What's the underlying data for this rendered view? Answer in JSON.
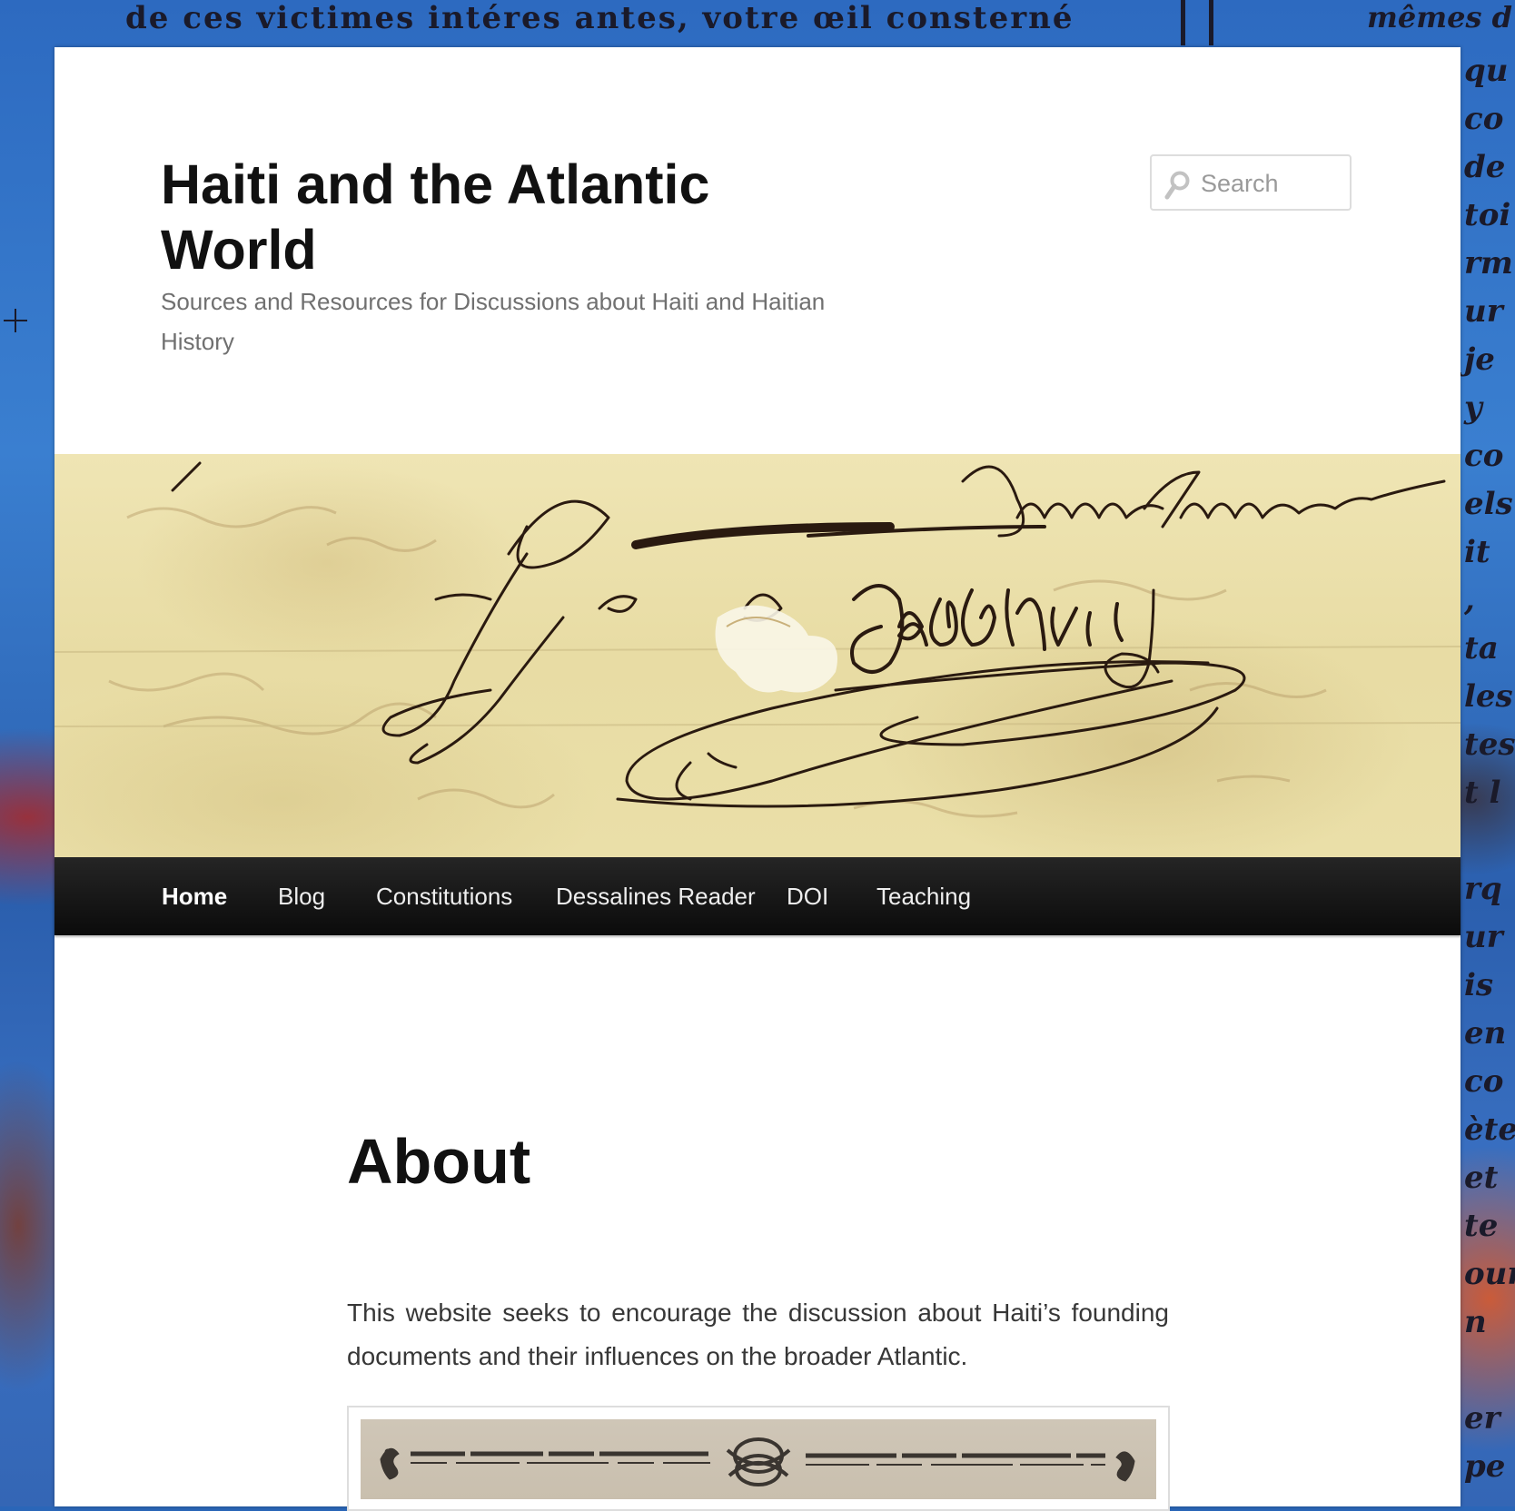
{
  "background": {
    "top_line": "de ces victimes intéres antes, votre œil consterné",
    "top_right": "mêmes d",
    "margin_column": [
      "qu",
      "co",
      "de",
      "toi",
      "rm",
      "ur",
      "je",
      "y co",
      "els",
      "it",
      ",",
      "ta",
      "les",
      "tes",
      "t l",
      "",
      "rq",
      "ur",
      "is",
      "en",
      "co",
      "ète",
      "et",
      "te",
      "our",
      "n",
      "",
      "er",
      "pe"
    ]
  },
  "site": {
    "title": "Haiti and the Atlantic World",
    "description": "Sources and Resources for Discussions about Haiti and Haitian History"
  },
  "search": {
    "placeholder": "Search",
    "value": ""
  },
  "nav": {
    "items": [
      {
        "label": "Home",
        "active": true
      },
      {
        "label": "Blog",
        "active": false
      },
      {
        "label": "Constitutions",
        "active": false
      },
      {
        "label": "Dessalines Reader",
        "active": false
      },
      {
        "label": "DOI",
        "active": false
      },
      {
        "label": "Teaching",
        "active": false
      }
    ]
  },
  "content": {
    "title": "About",
    "paragraph": "This website seeks to encourage the discussion about Haiti’s founding documents and their influences on the broader Atlantic."
  },
  "colors": {
    "nav_background": "#111111",
    "nav_text": "#eeeeee",
    "title_text": "#111111",
    "description_text": "#707070",
    "parchment": "#ebdfa8",
    "ink": "#2a1a10",
    "page_bg": "#ffffff",
    "backdrop_blue": "#2f6cc0"
  },
  "icons": {
    "search": "magnifier-icon"
  }
}
